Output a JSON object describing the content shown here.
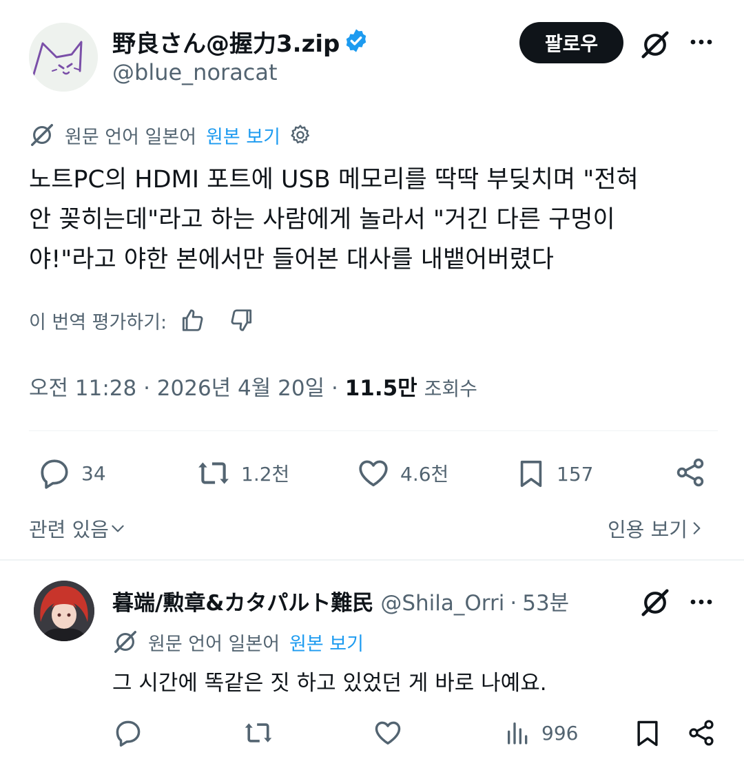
{
  "post": {
    "author_name": "野良さん@握力3.zip",
    "handle": "@blue_noracat",
    "follow_label": "팔로우",
    "translation": {
      "label": "원문 언어 일본어",
      "link": "원본 보기"
    },
    "text": "노트PC의 HDMI 포트에 USB 메모리를 딱딱 부딪치며 \"전혀\n안 꽂히는데\"라고 하는 사람에게 놀라서 \"거긴 다른 구멍이\n야!\"라고 야한 본에서만 들어본 대사를 내뱉어버렸다",
    "rate_label": "이 번역 평가하기:",
    "meta": {
      "time_date": "오전 11:28 · 2026년 4월 20일 · ",
      "views": "11.5만",
      "views_label": "조회수"
    },
    "actions": {
      "replies": "34",
      "reposts": "1.2천",
      "likes": "4.6천",
      "bookmarks": "157"
    },
    "related_label": "관련 있음",
    "quotes_label": "인용 보기"
  },
  "reply": {
    "author_name": "暮端/勲章&カタパルト難民",
    "handle": "@Shila_Orri",
    "dot": "·",
    "time": "53분",
    "translation": {
      "label": "원문 언어 일본어",
      "link": "원본 보기"
    },
    "text": "그 시간에 똑같은 짓 하고 있었던 게 바로 나예요.",
    "views": "996"
  },
  "colors": {
    "text": "#0f1419",
    "muted": "#536471",
    "accent": "#1d9bf0",
    "follow_bg": "#0f1419",
    "divider": "#eff3f4"
  }
}
